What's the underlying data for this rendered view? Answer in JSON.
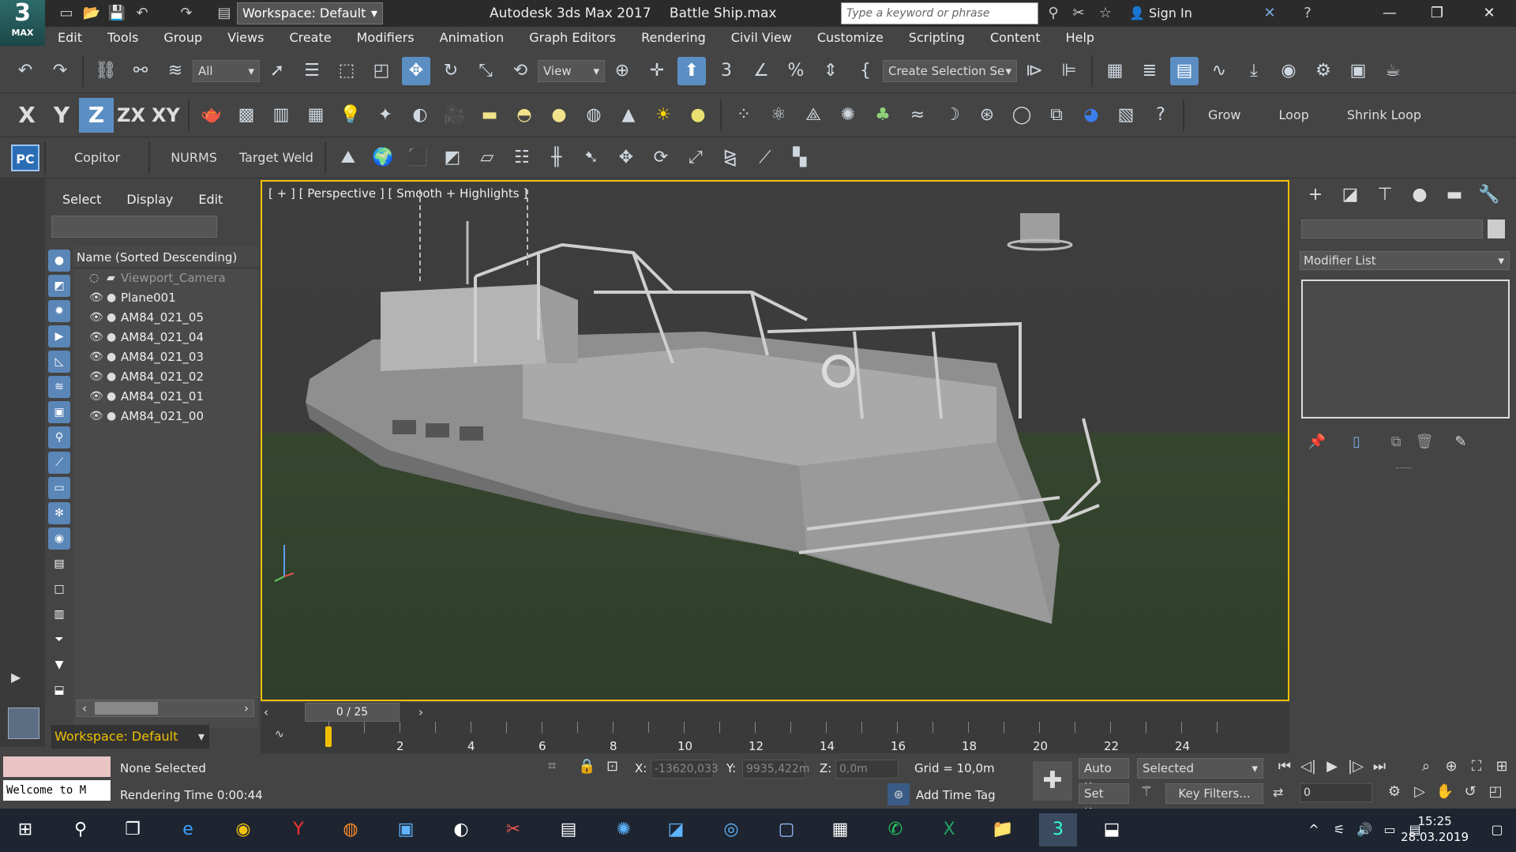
{
  "app": {
    "logo_number": "3",
    "logo_label": "MAX",
    "title": "Autodesk 3ds Max 2017",
    "file": "Battle Ship.max",
    "workspace": "Workspace: Default",
    "search_placeholder": "Type a keyword or phrase",
    "sign_in": "Sign In"
  },
  "menu": [
    "Edit",
    "Tools",
    "Group",
    "Views",
    "Create",
    "Modifiers",
    "Animation",
    "Graph Editors",
    "Rendering",
    "Civil View",
    "Customize",
    "Scripting",
    "Content",
    "Help"
  ],
  "toolbar": {
    "filter": "All",
    "coord_system": "View",
    "selection_set": "Create Selection Se"
  },
  "axis": {
    "x": "X",
    "y": "Y",
    "z": "Z",
    "zx": "ZX",
    "xy": "XY"
  },
  "ribbon": {
    "pc_label": "PC",
    "copitor": "Copitor",
    "nurms": "NURMS",
    "target_weld": "Target Weld",
    "grow": "Grow",
    "loop": "Loop",
    "shrink_loop": "Shrink Loop"
  },
  "explorer": {
    "menu": [
      "Select",
      "Display",
      "Edit"
    ],
    "header": "Name (Sorted Descending)",
    "rows": [
      {
        "name": "Viewport_Camera",
        "dim": true
      },
      {
        "name": "Plane001",
        "dim": false
      },
      {
        "name": "AM84_021_05",
        "dim": false
      },
      {
        "name": "AM84_021_04",
        "dim": false
      },
      {
        "name": "AM84_021_03",
        "dim": false
      },
      {
        "name": "AM84_021_02",
        "dim": false
      },
      {
        "name": "AM84_021_01",
        "dim": false
      },
      {
        "name": "AM84_021_00",
        "dim": false
      }
    ],
    "workspace": "Workspace: Default"
  },
  "viewport": {
    "label": "[ + ] [ Perspective ] [ Smooth + Highlights ]"
  },
  "command_panel": {
    "modifier_list": "Modifier List"
  },
  "timeline": {
    "frame": "0 / 25",
    "ticks": [
      "0",
      "2",
      "4",
      "6",
      "8",
      "10",
      "12",
      "14",
      "16",
      "18",
      "20",
      "22",
      "24"
    ]
  },
  "status": {
    "listener": "Welcome to M",
    "selection": "None Selected",
    "rendering_time": "Rendering Time  0:00:44",
    "x_label": "X:",
    "x_value": "-13620,033",
    "y_label": "Y:",
    "y_value": "9935,422m",
    "z_label": "Z:",
    "z_value": "0,0m",
    "grid": "Grid = 10,0m",
    "add_time_tag": "Add Time Tag",
    "auto_key": "Auto Key",
    "selected": "Selected",
    "set_key": "Set Key",
    "key_filters": "Key Filters...",
    "current_frame": "0"
  },
  "taskbar": {
    "time": "15:25",
    "date": "28.03.2019"
  },
  "colors": {
    "viewport_border": "#f0c000",
    "accent": "#5b8fc4",
    "workspace_text": "#f0c000"
  }
}
